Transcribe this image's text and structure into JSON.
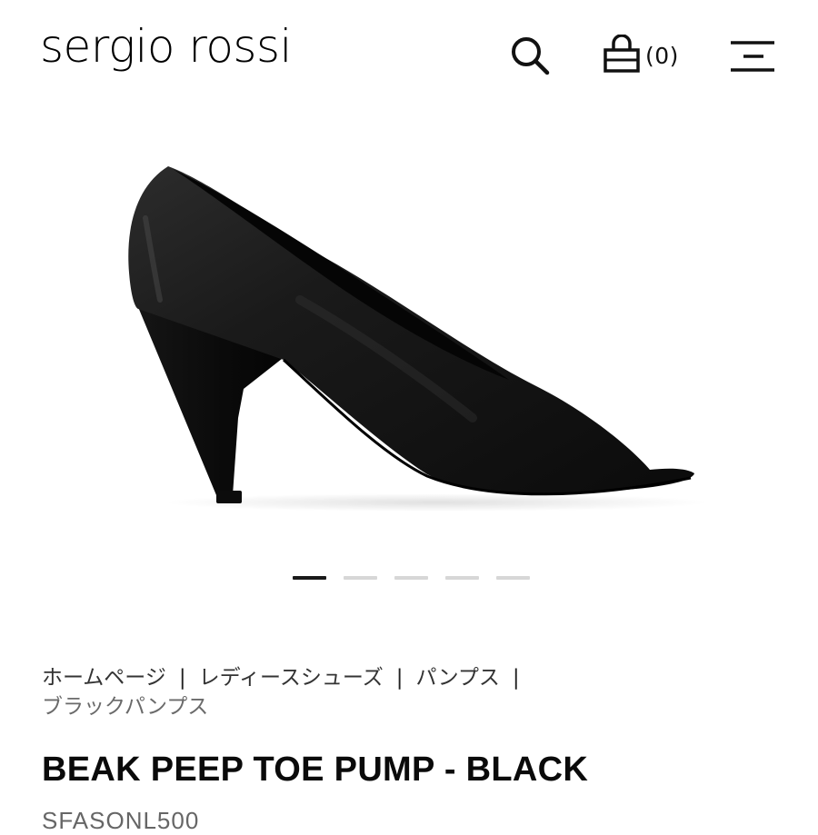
{
  "header": {
    "logo_text": "sergio rossi",
    "cart_count": "(0)",
    "icons": {
      "search": "search-icon",
      "cart": "shopping-bag-icon",
      "menu": "hamburger-menu-icon"
    }
  },
  "carousel": {
    "total_slides": 5,
    "active_index": 0
  },
  "breadcrumb": {
    "items": [
      "ホームページ",
      "レディースシューズ",
      "パンプス"
    ],
    "separator": "|",
    "current": "ブラックパンプス"
  },
  "product": {
    "title": "BEAK PEEP TOE PUMP - BLACK",
    "code": "SFASONL500"
  },
  "colors": {
    "text": "#111111",
    "dot_active": "#1a1a1a",
    "dot_inactive": "#d7d7d7",
    "breadcrumb_current": "#6a6a6a"
  }
}
